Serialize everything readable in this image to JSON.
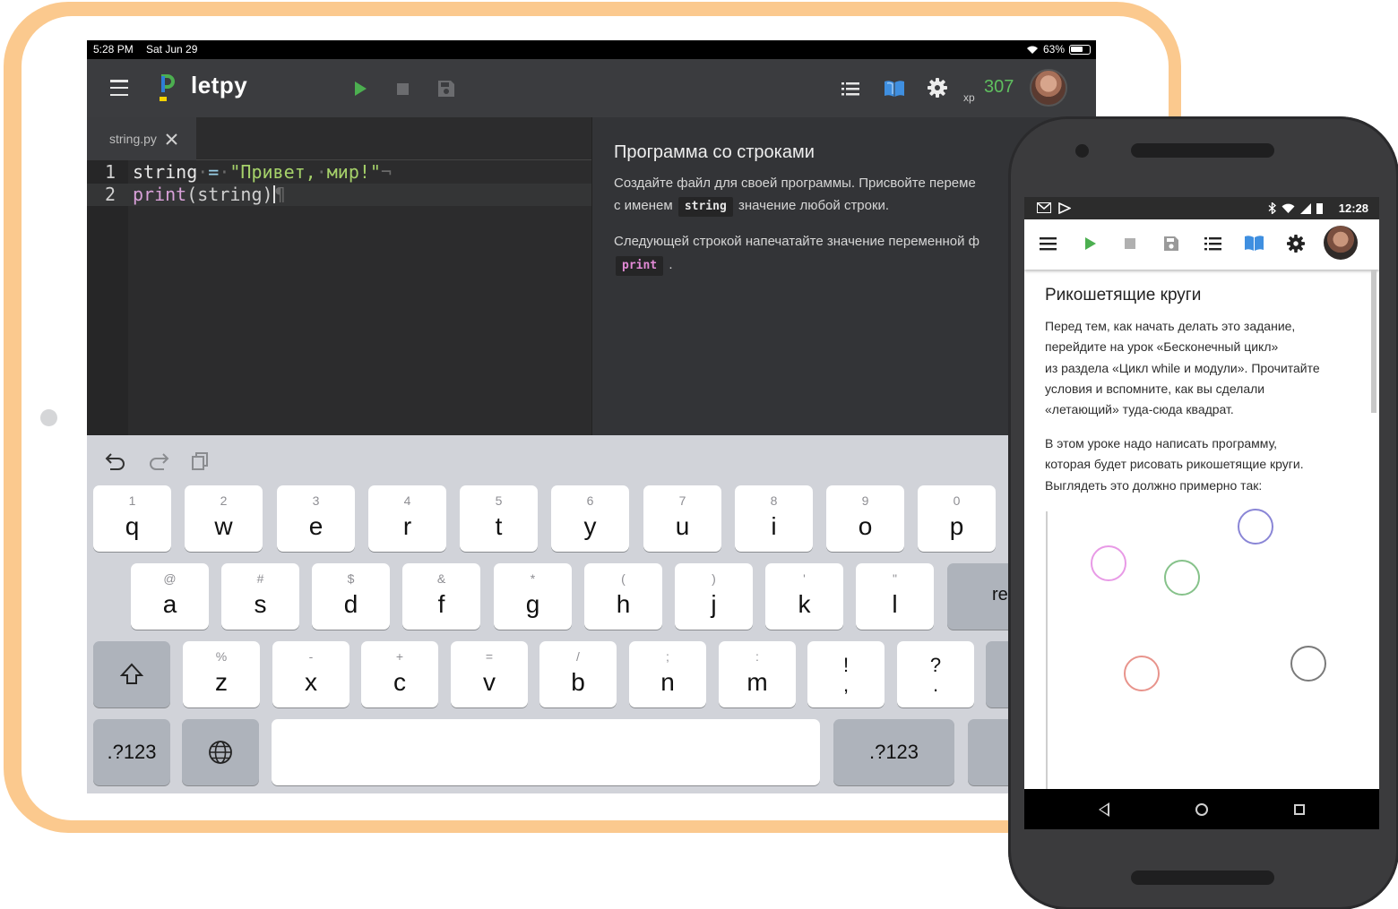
{
  "tablet": {
    "status_bar": {
      "time": "5:28 PM",
      "date": "Sat Jun 29",
      "battery": "63%"
    },
    "app": {
      "name": "letpy",
      "xp_label": "xp",
      "xp_value": "307",
      "accent_color": "#4caf50",
      "icons": [
        "menu-icon",
        "play-icon",
        "stop-icon",
        "save-icon",
        "list-icon",
        "book-icon",
        "gear-icon"
      ]
    },
    "editor": {
      "tab_label": "string.py",
      "lines": [
        {
          "number": "1",
          "text": "string = \"Привет, мир!\""
        },
        {
          "number": "2",
          "text": "print(string)"
        }
      ]
    },
    "task": {
      "title": "Программа со строками",
      "para1_line1": "Создайте файл для своей программы. Присвойте переме",
      "para1_line2_before": "с именем",
      "para1_code": "string",
      "para1_line2_after": "значение любой строки.",
      "para2_line1": "Следующей строкой напечатайте значение переменной ф",
      "para2_code": "print",
      "para2_after": "."
    },
    "keyboard": {
      "row1": [
        {
          "alt": "1",
          "main": "q"
        },
        {
          "alt": "2",
          "main": "w"
        },
        {
          "alt": "3",
          "main": "e"
        },
        {
          "alt": "4",
          "main": "r"
        },
        {
          "alt": "5",
          "main": "t"
        },
        {
          "alt": "6",
          "main": "y"
        },
        {
          "alt": "7",
          "main": "u"
        },
        {
          "alt": "8",
          "main": "i"
        },
        {
          "alt": "9",
          "main": "o"
        },
        {
          "alt": "0",
          "main": "p"
        }
      ],
      "row2": [
        {
          "alt": "@",
          "main": "a"
        },
        {
          "alt": "#",
          "main": "s"
        },
        {
          "alt": "$",
          "main": "d"
        },
        {
          "alt": "&",
          "main": "f"
        },
        {
          "alt": "*",
          "main": "g"
        },
        {
          "alt": "(",
          "main": "h"
        },
        {
          "alt": ")",
          "main": "j"
        },
        {
          "alt": "'",
          "main": "k"
        },
        {
          "alt": "\"",
          "main": "l"
        }
      ],
      "return_label": "re",
      "row3": [
        {
          "alt": "%",
          "main": "z"
        },
        {
          "alt": "-",
          "main": "x"
        },
        {
          "alt": "+",
          "main": "c"
        },
        {
          "alt": "=",
          "main": "v"
        },
        {
          "alt": "/",
          "main": "b"
        },
        {
          "alt": ";",
          "main": "n"
        },
        {
          "alt": ":",
          "main": "m"
        }
      ],
      "punct": [
        {
          "top": "!",
          "bottom": ","
        },
        {
          "top": "?",
          "bottom": "."
        }
      ],
      "numbers_label": ".?123"
    }
  },
  "phone": {
    "status_bar": {
      "time": "12:28"
    },
    "lesson": {
      "title": "Рикошетящие круги",
      "para1": [
        "Перед тем, как начать делать это задание,",
        "перейдите на урок «Бесконечный цикл»",
        "из раздела «Цикл while и модули». Прочитайте",
        "условия и вспомните, как вы сделали",
        "«летающий» туда-сюда квадрат."
      ],
      "para2": [
        "В этом уроке надо написать программу,",
        "которая будет рисовать рикошетящие круги.",
        "Выглядеть это должно примерно так:"
      ],
      "circle_colors": [
        "#8a86d6",
        "#e89ae6",
        "#86c28a",
        "#e8948c",
        "#7a7a7a"
      ]
    }
  }
}
